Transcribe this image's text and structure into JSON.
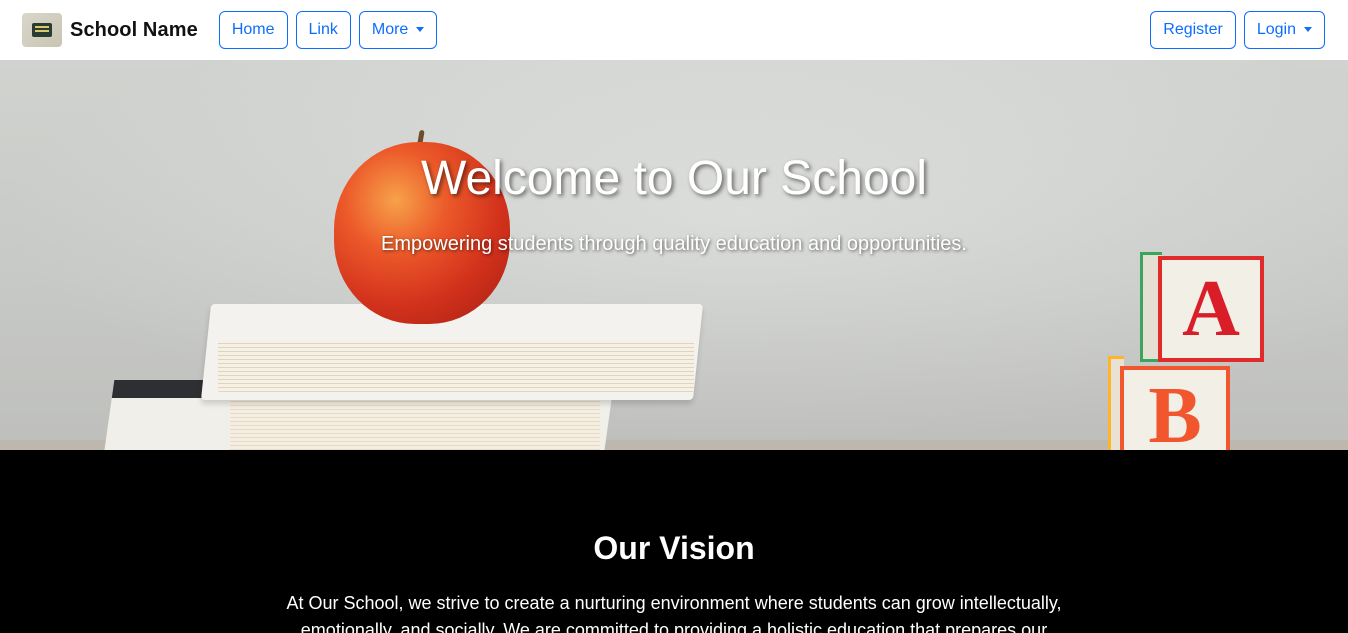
{
  "navbar": {
    "brand_name": "School Name",
    "logo_icon": "school-logo-icon",
    "left_links": [
      {
        "label": "Home"
      },
      {
        "label": "Link"
      },
      {
        "label": "More"
      }
    ],
    "right_links": [
      {
        "label": "Register"
      },
      {
        "label": "Login"
      }
    ],
    "accent_color": "#0d6efd"
  },
  "hero": {
    "title": "Welcome to Our School",
    "subtitle": "Empowering students through quality education and opportunities.",
    "block_letters": [
      "A",
      "B"
    ]
  },
  "vision": {
    "title": "Our Vision",
    "text": "At Our School, we strive to create a nurturing environment where students can grow intellectually, emotionally, and socially. We are committed to providing a holistic education that prepares our"
  }
}
